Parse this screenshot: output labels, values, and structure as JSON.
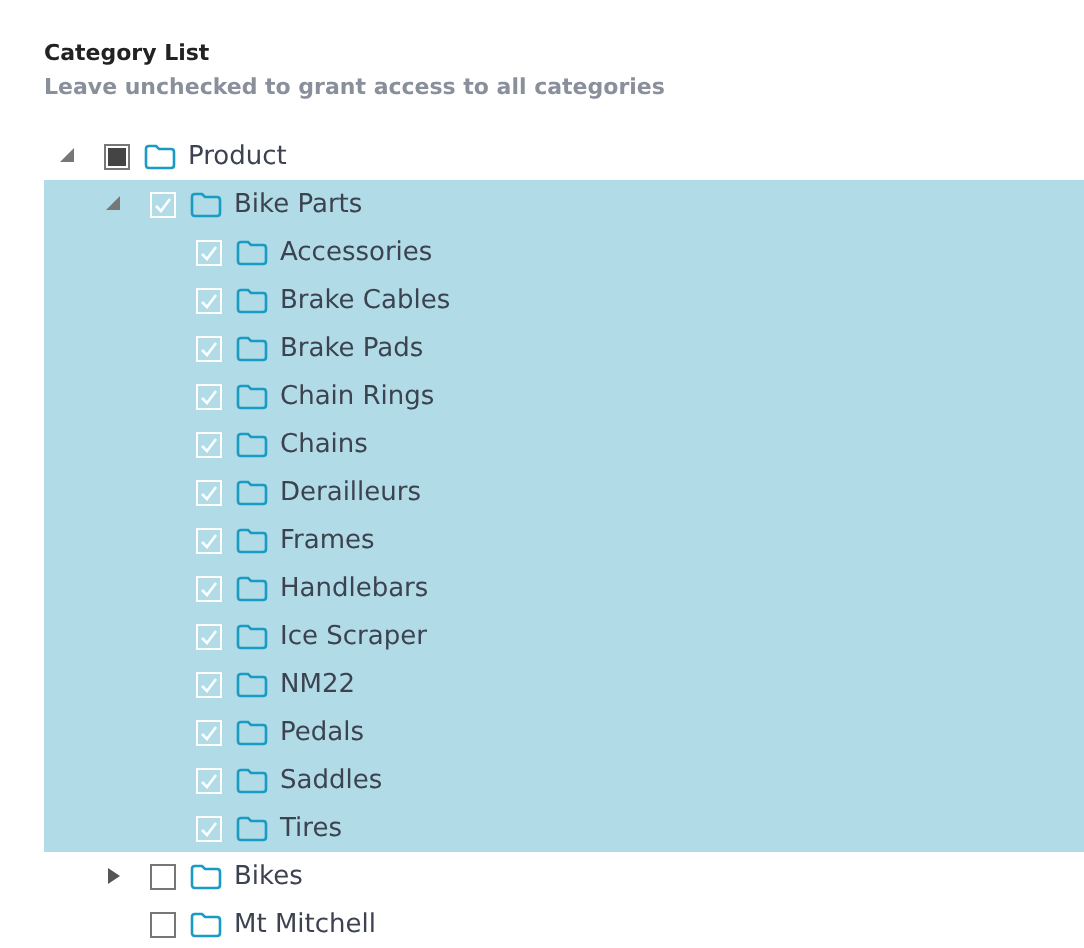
{
  "title": "Category List",
  "subtitle": "Leave unchecked to grant access to all categories",
  "tree": [
    {
      "label": "Product",
      "expanded": true,
      "checked": false,
      "indeterminate": true,
      "selected": false,
      "children": [
        {
          "label": "Bike Parts",
          "expanded": true,
          "checked": true,
          "indeterminate": false,
          "selected": true,
          "children": [
            {
              "label": "Accessories",
              "checked": true,
              "indeterminate": false,
              "selected": true
            },
            {
              "label": "Brake Cables",
              "checked": true,
              "indeterminate": false,
              "selected": true
            },
            {
              "label": "Brake Pads",
              "checked": true,
              "indeterminate": false,
              "selected": true
            },
            {
              "label": "Chain Rings",
              "checked": true,
              "indeterminate": false,
              "selected": true
            },
            {
              "label": "Chains",
              "checked": true,
              "indeterminate": false,
              "selected": true
            },
            {
              "label": "Derailleurs",
              "checked": true,
              "indeterminate": false,
              "selected": true
            },
            {
              "label": "Frames",
              "checked": true,
              "indeterminate": false,
              "selected": true
            },
            {
              "label": "Handlebars",
              "checked": true,
              "indeterminate": false,
              "selected": true
            },
            {
              "label": "Ice Scraper",
              "checked": true,
              "indeterminate": false,
              "selected": true
            },
            {
              "label": "NM22",
              "checked": true,
              "indeterminate": false,
              "selected": true
            },
            {
              "label": "Pedals",
              "checked": true,
              "indeterminate": false,
              "selected": true
            },
            {
              "label": "Saddles",
              "checked": true,
              "indeterminate": false,
              "selected": true
            },
            {
              "label": "Tires",
              "checked": true,
              "indeterminate": false,
              "selected": true
            }
          ]
        },
        {
          "label": "Bikes",
          "expanded": false,
          "checked": false,
          "indeterminate": false,
          "selected": false
        },
        {
          "label": "Mt Mitchell",
          "checked": false,
          "indeterminate": false,
          "selected": false
        }
      ]
    }
  ]
}
